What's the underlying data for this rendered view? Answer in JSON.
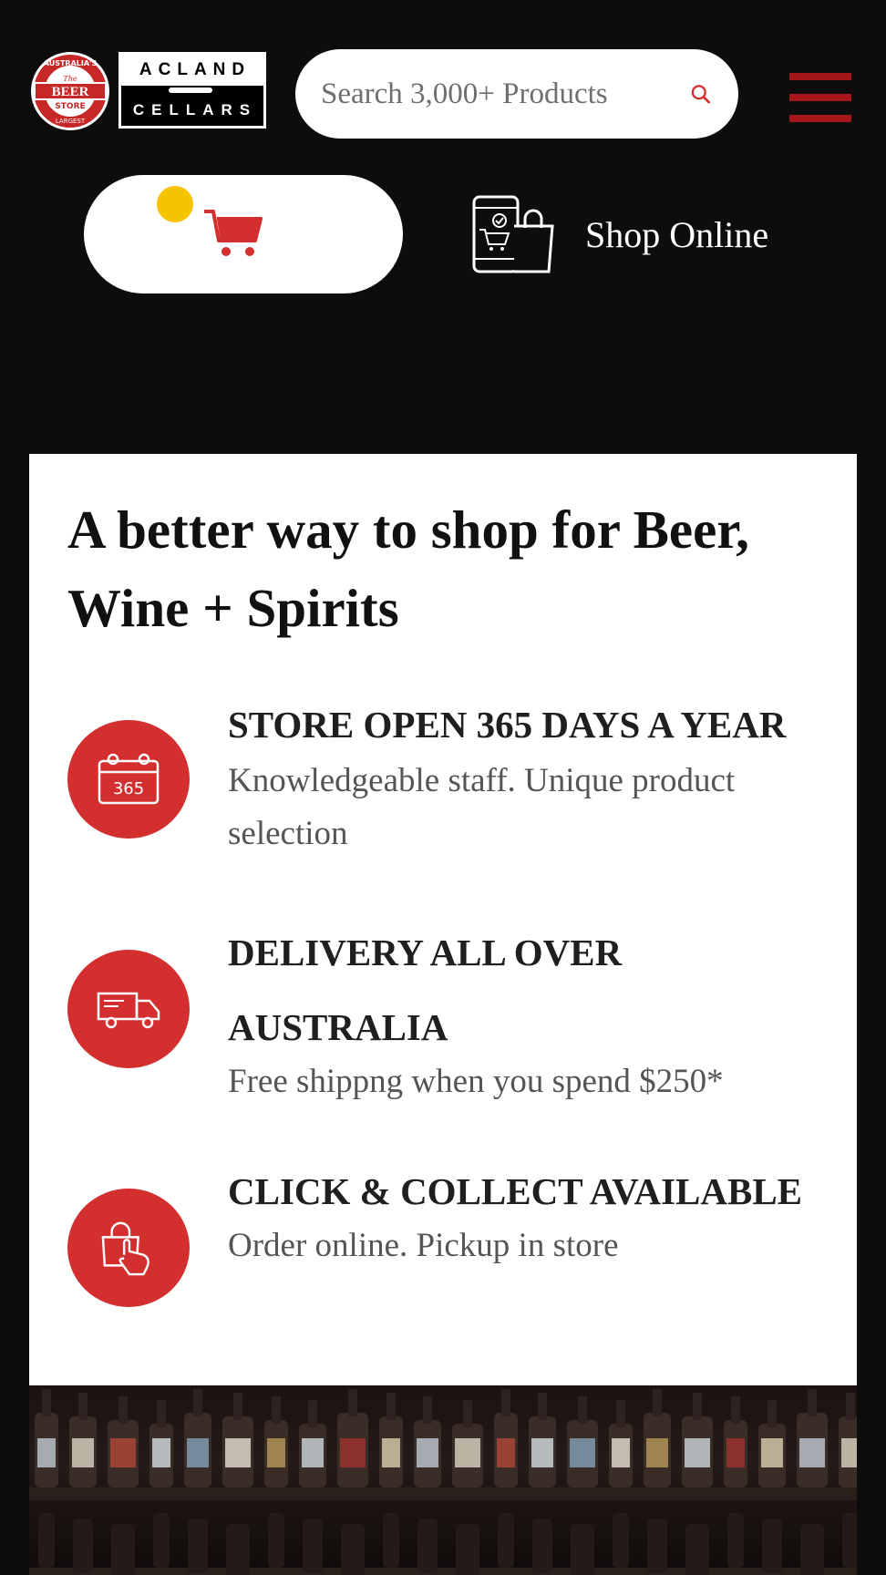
{
  "header": {
    "logo_beer_store": {
      "top_text": "AUSTRALIA'S",
      "the": "The",
      "main": "BEER",
      "store": "STORE",
      "bottom_text": "LARGEST"
    },
    "logo_acland": {
      "line1": "ACLAND",
      "line2": "CELLARS"
    },
    "search": {
      "placeholder": "Search 3,000+ Products"
    },
    "shop_online_label": "Shop Online"
  },
  "card": {
    "headline": "A better way to shop for Beer, Wine + Spirits",
    "features": [
      {
        "icon": "calendar-365-icon",
        "icon_text": "365",
        "title": "STORE OPEN 365 DAYS A YEAR",
        "description": "Knowledgeable staff. Unique product selection"
      },
      {
        "icon": "delivery-truck-icon",
        "title": "DELIVERY ALL OVER AUSTRALIA",
        "description": "Free shippng when you spend $250*"
      },
      {
        "icon": "click-collect-bag-icon",
        "title": "CLICK & COLLECT AVAILABLE",
        "description": "Order online. Pickup in store"
      }
    ]
  },
  "colors": {
    "background": "#0d0d0e",
    "accent_red": "#d32f2f",
    "hamburger_red": "#a4161a",
    "cart_badge_yellow": "#f5c400"
  }
}
